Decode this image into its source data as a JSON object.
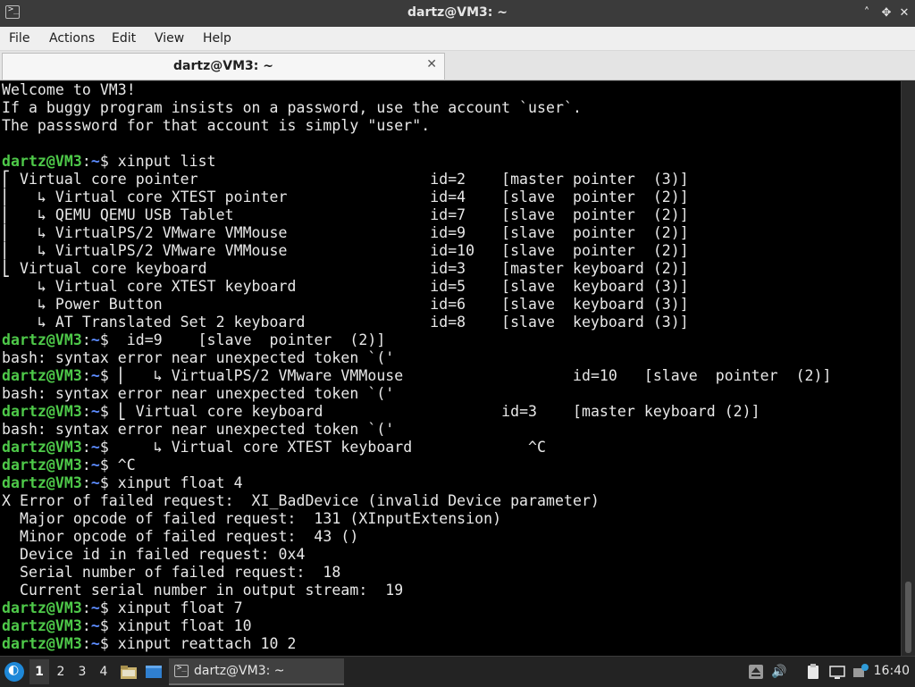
{
  "window": {
    "title": "dartz@VM3: ~",
    "minimize": "˄",
    "maximize": "✥",
    "close": "✕"
  },
  "menu": [
    "File",
    "Actions",
    "Edit",
    "View",
    "Help"
  ],
  "tab": {
    "label": "dartz@VM3: ~",
    "close": "✕"
  },
  "terminal": {
    "prompt_user": "dartz@VM3",
    "prompt_sep": ":",
    "prompt_path": "~",
    "lines": [
      {
        "text": "Welcome to VM3!"
      },
      {
        "text": "If a buggy program insists on a password, use the account `user`."
      },
      {
        "text": "The passsword for that account is simply \"user\"."
      },
      {
        "text": ""
      },
      {
        "prompt": true,
        "text": "$ xinput list"
      },
      {
        "text": "⎡ Virtual core pointer                    \tid=2    [master pointer  (3)]"
      },
      {
        "text": "⎜   ↳ Virtual core XTEST pointer              \tid=4    [slave  pointer  (2)]"
      },
      {
        "text": "⎜   ↳ QEMU QEMU USB Tablet                    \tid=7    [slave  pointer  (2)]"
      },
      {
        "text": "⎜   ↳ VirtualPS/2 VMware VMMouse              \tid=9    [slave  pointer  (2)]"
      },
      {
        "text": "⎜   ↳ VirtualPS/2 VMware VMMouse              \tid=10   [slave  pointer  (2)]"
      },
      {
        "text": "⎣ Virtual core keyboard                  \tid=3    [master keyboard (2)]"
      },
      {
        "text": "    ↳ Virtual core XTEST keyboard             \tid=5    [slave  keyboard (3)]"
      },
      {
        "text": "    ↳ Power Button                            \tid=6    [slave  keyboard (3)]"
      },
      {
        "text": "    ↳ AT Translated Set 2 keyboard            \tid=8    [slave  keyboard (3)]"
      },
      {
        "prompt": true,
        "text": "$  id=9    [slave  pointer  (2)]"
      },
      {
        "text": "bash: syntax error near unexpected token `('"
      },
      {
        "prompt": true,
        "text": "$ ⎜   ↳ VirtualPS/2 VMware VMMouse              \tid=10   [slave  pointer  (2)]"
      },
      {
        "text": "bash: syntax error near unexpected token `('"
      },
      {
        "prompt": true,
        "text": "$ ⎣ Virtual core keyboard                  \tid=3    [master keyboard (2)]"
      },
      {
        "text": "bash: syntax error near unexpected token `('"
      },
      {
        "prompt": true,
        "text": "$     ↳ Virtual core XTEST keyboard             ^C"
      },
      {
        "prompt": true,
        "text": "$ ^C"
      },
      {
        "prompt": true,
        "text": "$ xinput float 4"
      },
      {
        "text": "X Error of failed request:  XI_BadDevice (invalid Device parameter)"
      },
      {
        "text": "  Major opcode of failed request:  131 (XInputExtension)"
      },
      {
        "text": "  Minor opcode of failed request:  43 ()"
      },
      {
        "text": "  Device id in failed request: 0x4"
      },
      {
        "text": "  Serial number of failed request:  18"
      },
      {
        "text": "  Current serial number in output stream:  19"
      },
      {
        "prompt": true,
        "text": "$ xinput float 7"
      },
      {
        "prompt": true,
        "text": "$ xinput float 10"
      },
      {
        "prompt": true,
        "text": "$ xinput reattach 10 2"
      }
    ]
  },
  "taskbar": {
    "workspaces": [
      "1",
      "2",
      "3",
      "4"
    ],
    "active_workspace": "1",
    "task_label": "dartz@VM3: ~",
    "clock": "16:40"
  },
  "colors": {
    "prompt_user": "#4ec949",
    "prompt_path": "#5c8cff",
    "terminal_bg": "#000000",
    "terminal_fg": "#e8e8e8"
  }
}
